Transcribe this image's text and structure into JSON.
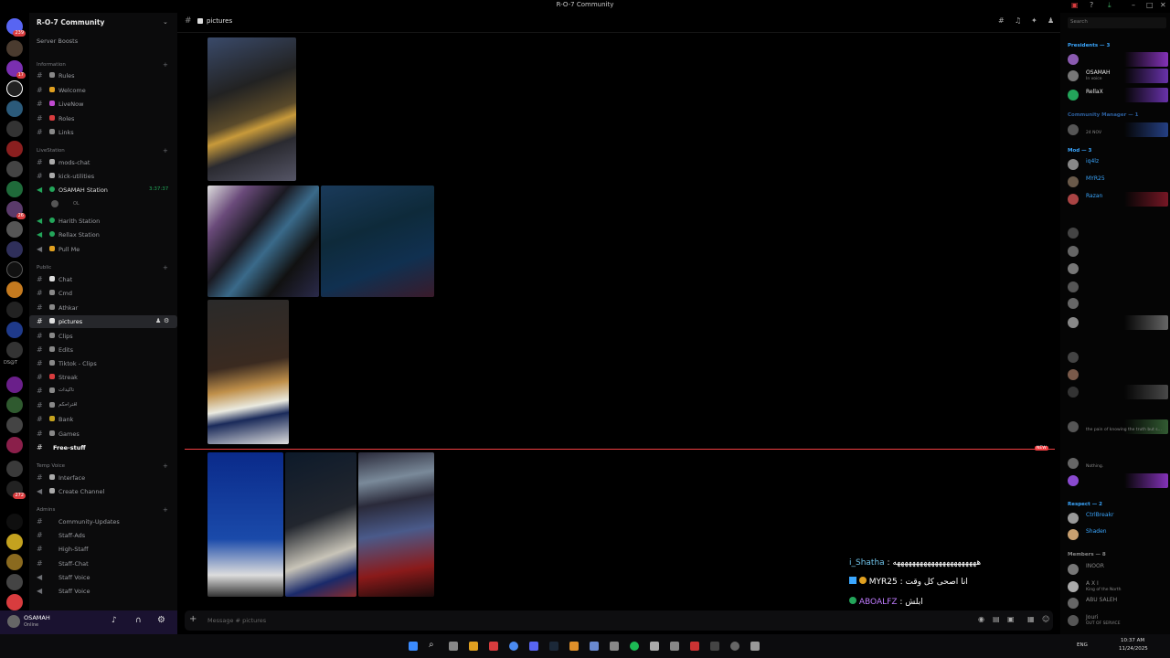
{
  "window": {
    "title": "R-O-7 Community"
  },
  "server": {
    "name": "R-O-7 Community",
    "boosts": "Server Boosts"
  },
  "server_rail": {
    "badges": [
      "239",
      "",
      "17",
      "",
      "1",
      "",
      "3",
      "1",
      "",
      "1",
      "2",
      "26",
      "1",
      "",
      "",
      "",
      "",
      "",
      "",
      "",
      "",
      "2",
      "",
      "",
      "",
      "",
      "",
      "",
      "",
      "",
      "",
      "272",
      ""
    ],
    "label_ds": "DS@T",
    "new_badge": "NEW"
  },
  "categories": [
    {
      "name": "Information",
      "channels": [
        "Rules",
        "Welcome",
        "LiveNow",
        "Roles",
        "Links"
      ]
    },
    {
      "name": "LiveStation",
      "channels": [
        "mods-chat",
        "kick-utilities",
        "OSAMAH Station",
        "Harith Station",
        "Rellax Station",
        "Pull Me"
      ]
    },
    {
      "name": "Public",
      "channels": [
        "Chat",
        "Cmd",
        "Athkar",
        "pictures",
        "Clips",
        "Edits",
        "Tiktok - Clips",
        "Streak",
        "تاكيدات",
        "اقتراحكم",
        "Bank",
        "Games",
        "Free-stuff"
      ]
    },
    {
      "name": "Temp Voice",
      "channels": [
        "Interface",
        "Create Channel"
      ]
    },
    {
      "name": "Admins",
      "channels": [
        "Community-Updates",
        "Staff-Ads",
        "High-Staff",
        "Staff-Chat",
        "Staff Voice",
        "Staff Voice"
      ]
    }
  ],
  "voice": {
    "timer": "3:37:37",
    "sub": "OL"
  },
  "user_panel": {
    "name": "OSAMAH",
    "status": "Online"
  },
  "header": {
    "channel": "pictures",
    "search_placeholder": "Search"
  },
  "chat_overlay": [
    {
      "name": "i_Shatha",
      "text": "ههههههههههههههههههههههه"
    },
    {
      "name": "MYR25",
      "text": "انا اصحى كل وقت"
    },
    {
      "name": "ABOALFZ",
      "text": "ابلش"
    }
  ],
  "new_marker": "NEW",
  "composer": {
    "placeholder": "Message # pictures"
  },
  "members": {
    "sections": [
      {
        "title": "Presidents — 3",
        "color": "#3ba7ff"
      },
      {
        "title": "Community Manager — 1",
        "color": "#2c5f9e"
      },
      {
        "title": "Mod — 3",
        "color": "#3ba7ff"
      },
      {
        "title": "Respect — 2",
        "color": "#3ba7ff"
      },
      {
        "title": "Members — 8",
        "color": "#888888"
      }
    ],
    "list": [
      {
        "name": "",
        "status": "",
        "color": "#d06bff"
      },
      {
        "name": "OSAMAH",
        "status": "In voice",
        "color": "#e8e8e8"
      },
      {
        "name": "RellaX",
        "status": "",
        "color": "#e8e8e8"
      },
      {
        "name": "",
        "status": "24 NOV",
        "color": "#3ba7ff"
      },
      {
        "name": "iq4lz",
        "status": "",
        "color": "#3ba7ff"
      },
      {
        "name": "MYR25",
        "status": "",
        "color": "#3ba7ff"
      },
      {
        "name": "Razan",
        "status": "",
        "color": "#3ba7ff"
      },
      {
        "name": "",
        "status": "",
        "color": "#7a4fb0"
      },
      {
        "name": "",
        "status": "",
        "color": "#7a4fb0"
      },
      {
        "name": "",
        "status": "",
        "color": "#7a4fb0"
      },
      {
        "name": "",
        "status": "",
        "color": "#7a4fb0"
      },
      {
        "name": "",
        "status": "",
        "color": "#7a4fb0"
      },
      {
        "name": "",
        "status": "",
        "color": "#7a4fb0"
      },
      {
        "name": "",
        "status": "",
        "color": "#7a4fb0"
      },
      {
        "name": "",
        "status": "",
        "color": "#7a4fb0"
      },
      {
        "name": "",
        "status": "",
        "color": "#7a4fb0"
      },
      {
        "name": "",
        "status": "the pain of knowing the truth but s...",
        "color": "#7a4fb0"
      },
      {
        "name": "",
        "status": "Nothing.",
        "color": "#7a4fb0"
      },
      {
        "name": "",
        "status": "",
        "color": "#7a4fb0"
      },
      {
        "name": "CtrlBreakr",
        "status": "",
        "color": "#3ba7ff"
      },
      {
        "name": "Shaden",
        "status": "",
        "color": "#3ba7ff"
      },
      {
        "name": "INOOR",
        "status": "",
        "color": "#888888"
      },
      {
        "name": "A X I",
        "status": "King of the North",
        "color": "#888888"
      },
      {
        "name": "ABU SALEH",
        "status": "",
        "color": "#888888"
      },
      {
        "name": "Jouri",
        "status": "OUT OF SERVICE",
        "color": "#888888"
      }
    ]
  },
  "taskbar": {
    "lang": "ENG",
    "time": "10:37 AM",
    "date": "11/24/2025"
  },
  "colors": {
    "accent": "#5865f2",
    "new_line": "#f23f43",
    "online": "#23a55a"
  },
  "icons": [
    "hash-icon",
    "search-icon",
    "pin-icon",
    "bell-icon",
    "members-icon",
    "mic-icon",
    "headset-icon",
    "gear-icon",
    "plus-icon",
    "gift-icon",
    "gif-icon",
    "sticker-icon",
    "emoji-icon"
  ]
}
